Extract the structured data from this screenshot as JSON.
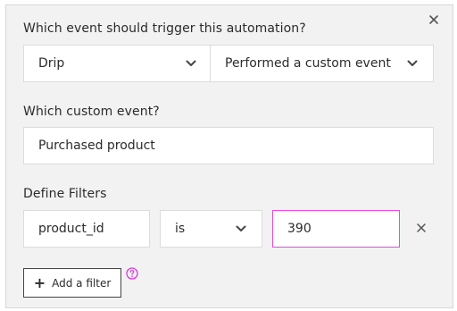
{
  "dialog": {
    "close_label": "×"
  },
  "trigger": {
    "heading": "Which event should trigger this automation?",
    "source_value": "Drip",
    "event_type_value": "Performed a custom event"
  },
  "custom_event": {
    "heading": "Which custom event?",
    "value": "Purchased product"
  },
  "filters": {
    "heading": "Define Filters",
    "rows": [
      {
        "property": "product_id",
        "operator": "is",
        "value": "390"
      }
    ],
    "add_label": "Add a filter",
    "add_icon": "+",
    "help_icon": "question-circle-icon"
  },
  "colors": {
    "panel_bg": "#f2f2f2",
    "focus_border": "#e64ce0",
    "help_icon": "#d63ad6"
  }
}
